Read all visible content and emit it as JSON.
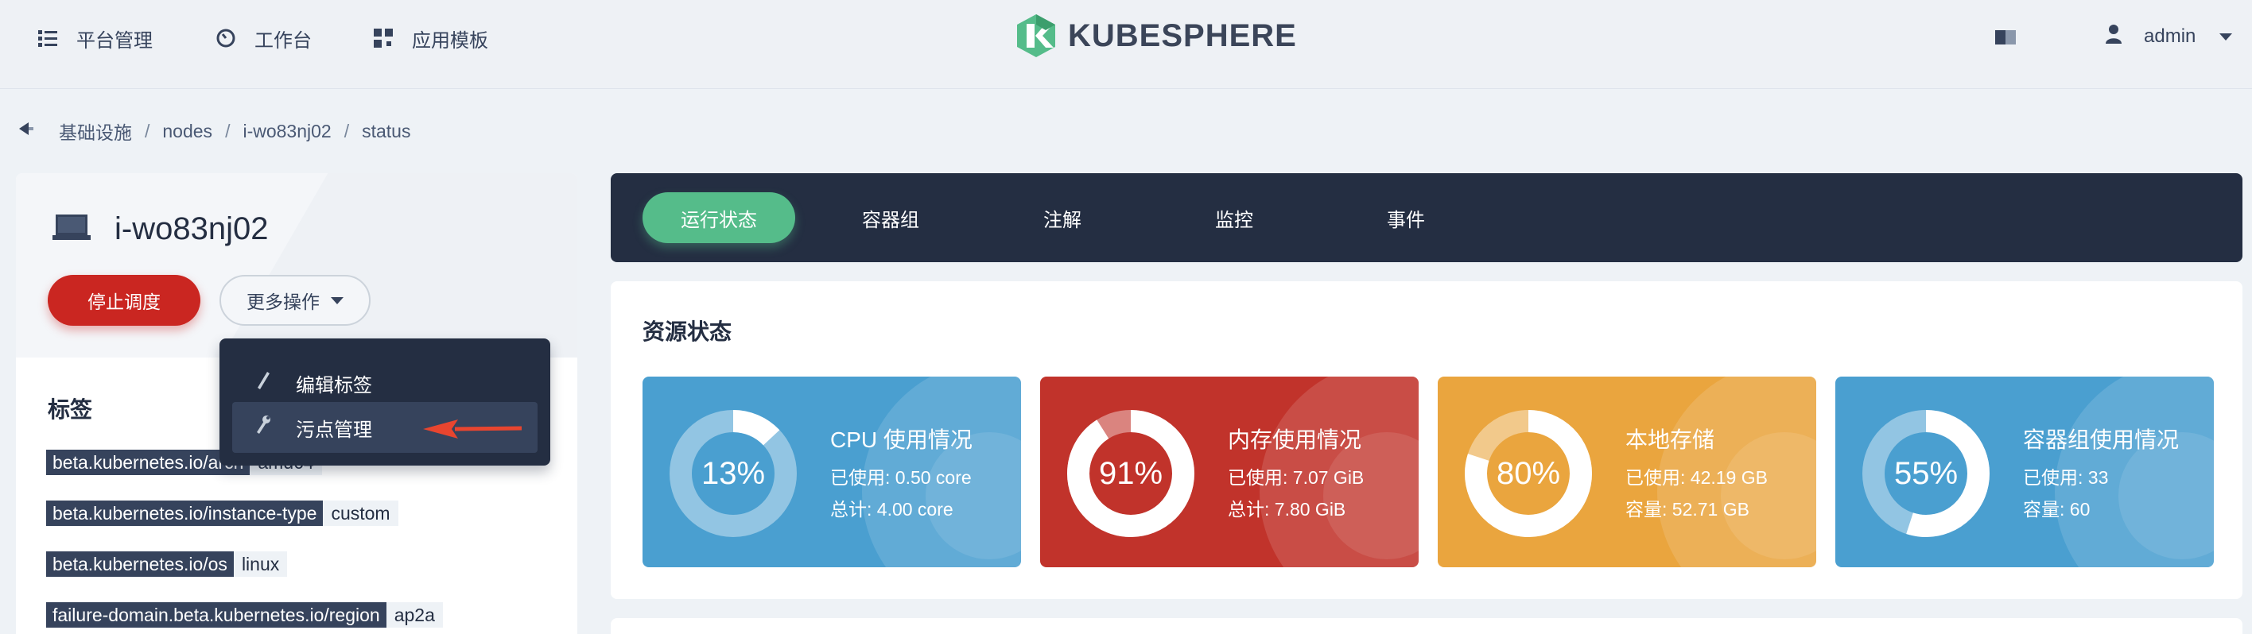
{
  "topbar": {
    "nav": [
      {
        "label": "平台管理",
        "icon": "list-icon"
      },
      {
        "label": "工作台",
        "icon": "dashboard-icon"
      },
      {
        "label": "应用模板",
        "icon": "apps-icon"
      }
    ],
    "logo_text": "KUBESPHERE",
    "user": "admin"
  },
  "breadcrumb": [
    "基础设施",
    "nodes",
    "i-wo83nj02",
    "status"
  ],
  "node": {
    "name": "i-wo83nj02",
    "stop_button": "停止调度",
    "more_button": "更多操作"
  },
  "labels": {
    "title": "标签",
    "items": [
      {
        "key": "beta.kubernetes.io/arch",
        "value": "amd64"
      },
      {
        "key": "beta.kubernetes.io/instance-type",
        "value": "custom"
      },
      {
        "key": "beta.kubernetes.io/os",
        "value": "linux"
      },
      {
        "key": "failure-domain.beta.kubernetes.io/region",
        "value": "ap2a"
      }
    ]
  },
  "dropdown": {
    "items": [
      {
        "label": "编辑标签",
        "icon": "pen-icon"
      },
      {
        "label": "污点管理",
        "icon": "wrench-icon"
      }
    ]
  },
  "tabs": [
    "运行状态",
    "容器组",
    "注解",
    "监控",
    "事件"
  ],
  "resources": {
    "title": "资源状态",
    "tiles": [
      {
        "name": "CPU 使用情况",
        "percent": "13%",
        "value": 0.13,
        "line1": "已使用: 0.50 core",
        "line2": "总计: 4.00 core",
        "color": "#4a9fd0"
      },
      {
        "name": "内存使用情况",
        "percent": "91%",
        "value": 0.91,
        "line1": "已使用: 7.07 GiB",
        "line2": "总计: 7.80 GiB",
        "color": "#c1332b"
      },
      {
        "name": "本地存储",
        "percent": "80%",
        "value": 0.8,
        "line1": "已使用: 42.19 GB",
        "line2": "容量: 52.71 GB",
        "color": "#eaa53e"
      },
      {
        "name": "容器组使用情况",
        "percent": "55%",
        "value": 0.55,
        "line1": "已使用: 33",
        "line2": "容量: 60",
        "color": "#4a9fd0"
      }
    ]
  }
}
